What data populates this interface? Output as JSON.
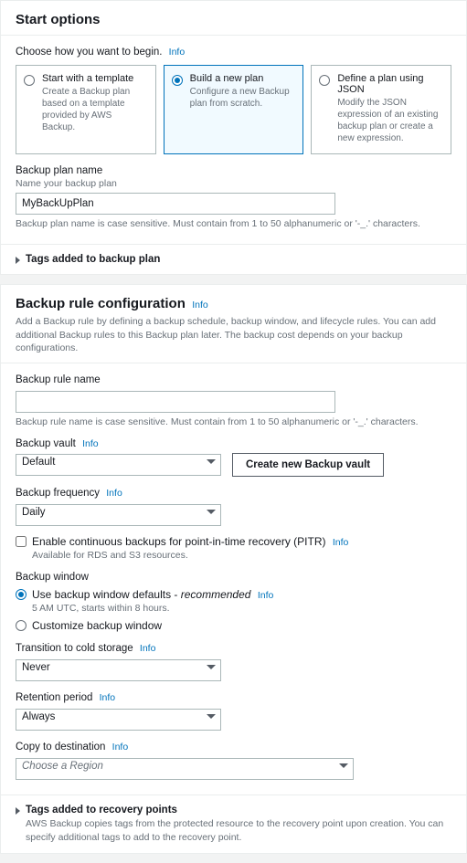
{
  "start_options": {
    "title": "Start options",
    "choose_label": "Choose how you want to begin.",
    "info": "Info",
    "tiles": [
      {
        "title": "Start with a template",
        "desc": "Create a Backup plan based on a template provided by AWS Backup."
      },
      {
        "title": "Build a new plan",
        "desc": "Configure a new Backup plan from scratch."
      },
      {
        "title": "Define a plan using JSON",
        "desc": "Modify the JSON expression of an existing backup plan or create a new expression."
      }
    ],
    "plan_name": {
      "label": "Backup plan name",
      "sublabel": "Name your backup plan",
      "value": "MyBackUpPlan",
      "hint": "Backup plan name is case sensitive. Must contain from 1 to 50 alphanumeric or '-_.' characters."
    },
    "tags_expander": "Tags added to backup plan"
  },
  "rule_config": {
    "title": "Backup rule configuration",
    "info": "Info",
    "desc": "Add a Backup rule by defining a backup schedule, backup window, and lifecycle rules. You can add additional Backup rules to this Backup plan later. The backup cost depends on your backup configurations.",
    "rule_name": {
      "label": "Backup rule name",
      "value": "",
      "hint": "Backup rule name is case sensitive. Must contain from 1 to 50 alphanumeric or '-_.' characters."
    },
    "vault": {
      "label": "Backup vault",
      "info": "Info",
      "value": "Default",
      "create_btn": "Create new Backup vault"
    },
    "frequency": {
      "label": "Backup frequency",
      "info": "Info",
      "value": "Daily"
    },
    "pitr": {
      "label": "Enable continuous backups for point-in-time recovery (PITR)",
      "info": "Info",
      "hint": "Available for RDS and S3 resources."
    },
    "window": {
      "label": "Backup window",
      "default_opt": "Use backup window defaults - ",
      "recommended": "recommended",
      "info": "Info",
      "default_hint": "5 AM UTC, starts within 8 hours.",
      "custom_opt": "Customize backup window"
    },
    "cold_storage": {
      "label": "Transition to cold storage",
      "info": "Info",
      "value": "Never"
    },
    "retention": {
      "label": "Retention period",
      "info": "Info",
      "value": "Always"
    },
    "copy_dest": {
      "label": "Copy to destination",
      "info": "Info",
      "placeholder": "Choose a Region"
    },
    "recovery_tags": {
      "title": "Tags added to recovery points",
      "desc": "AWS Backup copies tags from the protected resource to the recovery point upon creation. You can specify additional tags to add to the recovery point."
    }
  }
}
